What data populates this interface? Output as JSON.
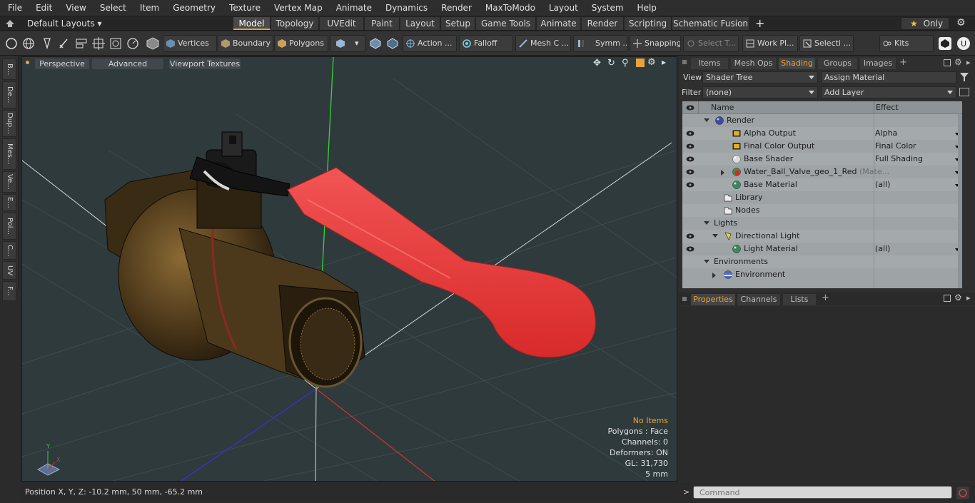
{
  "menu": [
    "File",
    "Edit",
    "View",
    "Select",
    "Item",
    "Geometry",
    "Texture",
    "Vertex Map",
    "Animate",
    "Dynamics",
    "Render",
    "MaxToModo",
    "Layout",
    "System",
    "Help"
  ],
  "layout_selector": "Default Layouts",
  "layout_tabs": [
    "Model",
    "Topology",
    "UVEdit",
    "Paint",
    "Layout",
    "Setup",
    "Game Tools",
    "Animate",
    "Render",
    "Scripting",
    "Schematic Fusion"
  ],
  "add_tab_label": "+",
  "only_label": "Only",
  "toolbar": {
    "vertices": "Vertices",
    "boundary": "Boundary",
    "polygons": "Polygons",
    "action": "Action ...",
    "falloff": "Falloff",
    "mesh": "Mesh C ...",
    "symm": "Symm ...",
    "snapping": "Snapping",
    "select_t": "Select T...",
    "work_pl": "Work Pl...",
    "selecti": "Selecti ...",
    "kits": "Kits"
  },
  "left_tabs": [
    "B...",
    "De...",
    "Dup...",
    "Mes...",
    "Ve...",
    "E...",
    "Pol...",
    "C...",
    "UV",
    "F..."
  ],
  "viewport": {
    "tabs": [
      "Perspective",
      "Advanced",
      "Viewport Textures"
    ],
    "hud": {
      "no_items": "No Items",
      "polygons": "Polygons : Face",
      "channels": "Channels: 0",
      "deformers": "Deformers: ON",
      "gl": "GL: 31,730",
      "unit": "5 mm"
    },
    "axis_y": "Y",
    "axis_x": "X"
  },
  "status": {
    "position": "Position X, Y, Z:   -10.2 mm, 50 mm, -65.2 mm"
  },
  "panel": {
    "tabs": [
      "Items",
      "Mesh Ops",
      "Shading",
      "Groups",
      "Images"
    ],
    "active_tab": "Shading",
    "view_label": "View",
    "view_value": "Shader Tree",
    "assign_material": "Assign Material",
    "filter_label": "Filter",
    "filter_value": "(none)",
    "add_layer": "Add Layer",
    "col_name": "Name",
    "col_effect": "Effect",
    "rows": [
      {
        "name": "Render",
        "effect": "",
        "eye": false,
        "indent": 0,
        "expand": "down",
        "icon": "sphere-blue"
      },
      {
        "name": "Alpha Output",
        "effect": "Alpha",
        "eye": true,
        "indent": 2,
        "expand": "",
        "icon": "output"
      },
      {
        "name": "Final Color Output",
        "effect": "Final Color",
        "eye": true,
        "indent": 2,
        "expand": "",
        "icon": "output"
      },
      {
        "name": "Base Shader",
        "effect": "Full Shading",
        "eye": true,
        "indent": 2,
        "expand": "",
        "icon": "sphere-white"
      },
      {
        "name": "Water_Ball_Valve_geo_1_Red",
        "effect": "",
        "eye": true,
        "indent": 2,
        "expand": "right",
        "icon": "sphere-red",
        "suffix": "(Mate..."
      },
      {
        "name": "Base Material",
        "effect": "(all)",
        "eye": true,
        "indent": 2,
        "expand": "",
        "icon": "sphere-green"
      },
      {
        "name": "Library",
        "effect": "",
        "eye": false,
        "indent": 1,
        "expand": "",
        "icon": "folder"
      },
      {
        "name": "Nodes",
        "effect": "",
        "eye": false,
        "indent": 1,
        "expand": "",
        "icon": "folder"
      },
      {
        "name": "Lights",
        "effect": "",
        "eye": false,
        "indent": 0,
        "expand": "down",
        "icon": ""
      },
      {
        "name": "Directional Light",
        "effect": "",
        "eye": true,
        "indent": 1,
        "expand": "down",
        "icon": "light"
      },
      {
        "name": "Light Material",
        "effect": "(all)",
        "eye": true,
        "indent": 2,
        "expand": "",
        "icon": "sphere-green"
      },
      {
        "name": "Environments",
        "effect": "",
        "eye": false,
        "indent": 0,
        "expand": "down",
        "icon": ""
      },
      {
        "name": "Environment",
        "effect": "",
        "eye": false,
        "indent": 1,
        "expand": "right",
        "icon": "sphere-env"
      }
    ],
    "bottom_tabs": [
      "Properties",
      "Channels",
      "Lists"
    ],
    "command_placeholder": "Command"
  },
  "colors": {
    "accent": "#f0a330",
    "handle_red": "#e83a3a",
    "brass": "#5a4523",
    "viewport_bg": "#2f3a3d"
  }
}
